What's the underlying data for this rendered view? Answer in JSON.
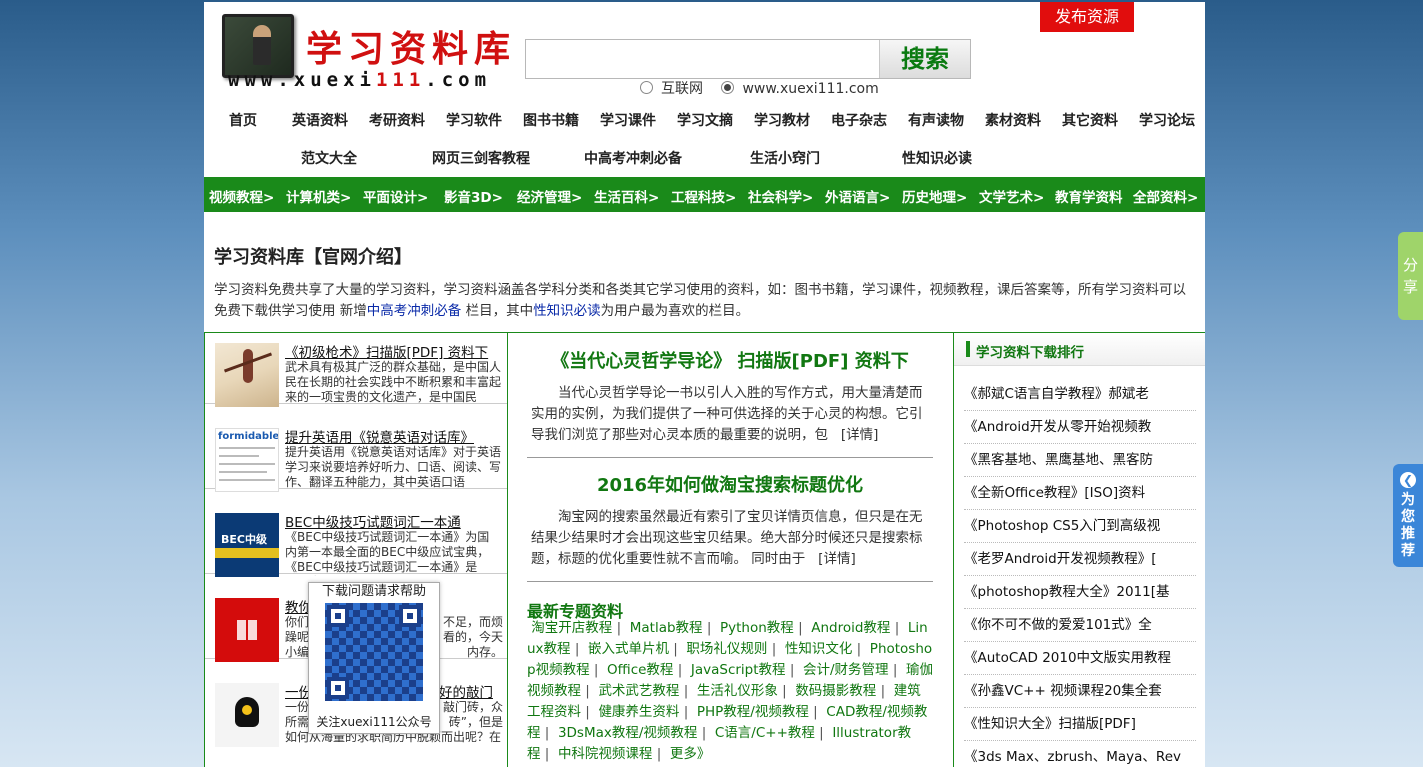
{
  "header": {
    "logo_cn": "学习资料库",
    "logo_en_prefix": "www.xuexi",
    "logo_en_num": "111",
    "logo_en_suffix": ".com",
    "search_placeholder": "",
    "search_button": "搜索",
    "radio_1": "互联网",
    "radio_2": "www.xuexi111.com",
    "publish_button": "发布资源"
  },
  "nav1": [
    "首页",
    "英语资料",
    "考研资料",
    "学习软件",
    "图书书籍",
    "学习课件",
    "学习文摘",
    "学习教材",
    "电子杂志",
    "有声读物",
    "素材资料",
    "其它资料",
    "学习论坛"
  ],
  "nav2": [
    "范文大全",
    "网页三剑客教程",
    "中高考冲刺必备",
    "生活小窍门",
    "性知识必读"
  ],
  "category_bar": [
    "视频教程>",
    "计算机类>",
    "平面设计>",
    "影音3D>",
    "经济管理>",
    "生活百科>",
    "工程科技>",
    "社会科学>",
    "外语语言>",
    "历史地理>",
    "文学艺术>",
    "教育学资料",
    "全部资料>"
  ],
  "intro": {
    "heading": "学习资料库【官网介绍】",
    "text_1": "学习资料免费共享了大量的学习资料，学习资料涵盖各学科分类和各类其它学习使用的资料，如：图书书籍，学习课件，视频教程，课后答案等，所有学习资料可以免费下载供学习使用 新增",
    "link_1": "中高考冲刺必备",
    "text_2": " 栏目，其中",
    "link_2": "性知识必读",
    "text_3": "为用户最为喜欢的栏目。"
  },
  "left_items": [
    {
      "title": "《初级枪术》扫描版[PDF] 资料下",
      "desc": "武术具有极其广泛的群众基础，是中国人民在长期的社会实践中不断积累和丰富起来的一项宝贵的文化遗产，是中国民"
    },
    {
      "title": "提升英语用《锐意英语对话库》",
      "desc": "提升英语用《锐意英语对话库》对于英语学习来说要培养好听力、口语、阅读、写作、翻译五种能力，其中英语口语"
    },
    {
      "title": "BEC中级技巧试题词汇一本通",
      "desc": "《BEC中级技巧试题词汇一本通》为国内第一本最全面的BEC中级应试宝典，《BEC中级技巧试题词汇一本通》是BEC商"
    },
    {
      "title": "教你",
      "desc_a": "你们",
      "desc_b": "躁呢",
      "desc_c": "小编",
      "desc_r1": "不足，而烦",
      "desc_r2": "看的，今天",
      "desc_r3": "内存。"
    },
    {
      "title_a": "一份",
      "title_b": "好的敲门",
      "desc_a": "一份",
      "desc_b": "所需",
      "desc_r1": "敲门砖，众",
      "desc_r2": "砖”，但是",
      "desc_c": "如何从海量的求职简历中脱颖而出呢？在"
    }
  ],
  "thumb_text": {
    "t2": "formidable",
    "t3": "BEC中级"
  },
  "qr": {
    "title": "下载问题请求帮助",
    "caption": "关注xuexi111公众号"
  },
  "articles": [
    {
      "title": "《当代心灵哲学导论》 扫描版[PDF] 资料下",
      "body": "当代心灵哲学导论一书以引人入胜的写作方式，用大量清楚而实用的实例，为我们提供了一种可供选择的关于心灵的构想。它引导我们浏览了那些对心灵本质的最重要的说明，包",
      "more": "[详情]"
    },
    {
      "title": "2016年如何做淘宝搜索标题优化",
      "body": "淘宝网的搜索虽然最近有索引了宝贝详情页信息，但只是在无结果少结果时才会出现这些宝贝结果。绝大部分时候还只是搜索标题，标题的优化重要性就不言而喻。 同时由于",
      "more": "[详情]"
    }
  ],
  "topics": {
    "heading": "最新专题资料",
    "items": [
      "淘宝开店教程",
      "Matlab教程",
      "Python教程",
      "Android教程",
      "Linux教程",
      "嵌入式单片机",
      "职场礼仪规则",
      "性知识文化",
      "Photoshop视频教程",
      "Office教程",
      "JavaScript教程",
      "会计/财务管理",
      "瑜伽视频教程",
      "武术武艺教程",
      "生活礼仪形象",
      "数码摄影教程",
      "建筑工程资料",
      "健康养生资料",
      "PHP教程/视频教程",
      "CAD教程/视频教程",
      "3DsMax教程/视频教程",
      "C语言/C++教程",
      "Illustrator教程",
      "中科院视频课程",
      "更多》"
    ]
  },
  "ranking": {
    "heading": "学习资料下载排行",
    "items": [
      "《郝斌C语言自学教程》郝斌老",
      "《Android开发从零开始视频教",
      "《黑客基地、黑鹰基地、黑客防",
      "《全新Office教程》[ISO]资料",
      "《Photoshop CS5入门到高级视",
      "《老罗Android开发视频教程》[",
      "《photoshop教程大全》2011[基",
      "《你不可不做的爱爱101式》全",
      "《AutoCAD 2010中文版实用教程",
      "《孙鑫VC++ 视频课程20集全套",
      "《性知识大全》扫描版[PDF]",
      "《3ds Max、zbrush、Maya、Rev"
    ]
  },
  "side": {
    "share": "分享",
    "recommend": "为您推荐"
  },
  "colors": {
    "green": "#1a8a1a",
    "red": "#e10d0d",
    "blue": "#3b86d8"
  }
}
